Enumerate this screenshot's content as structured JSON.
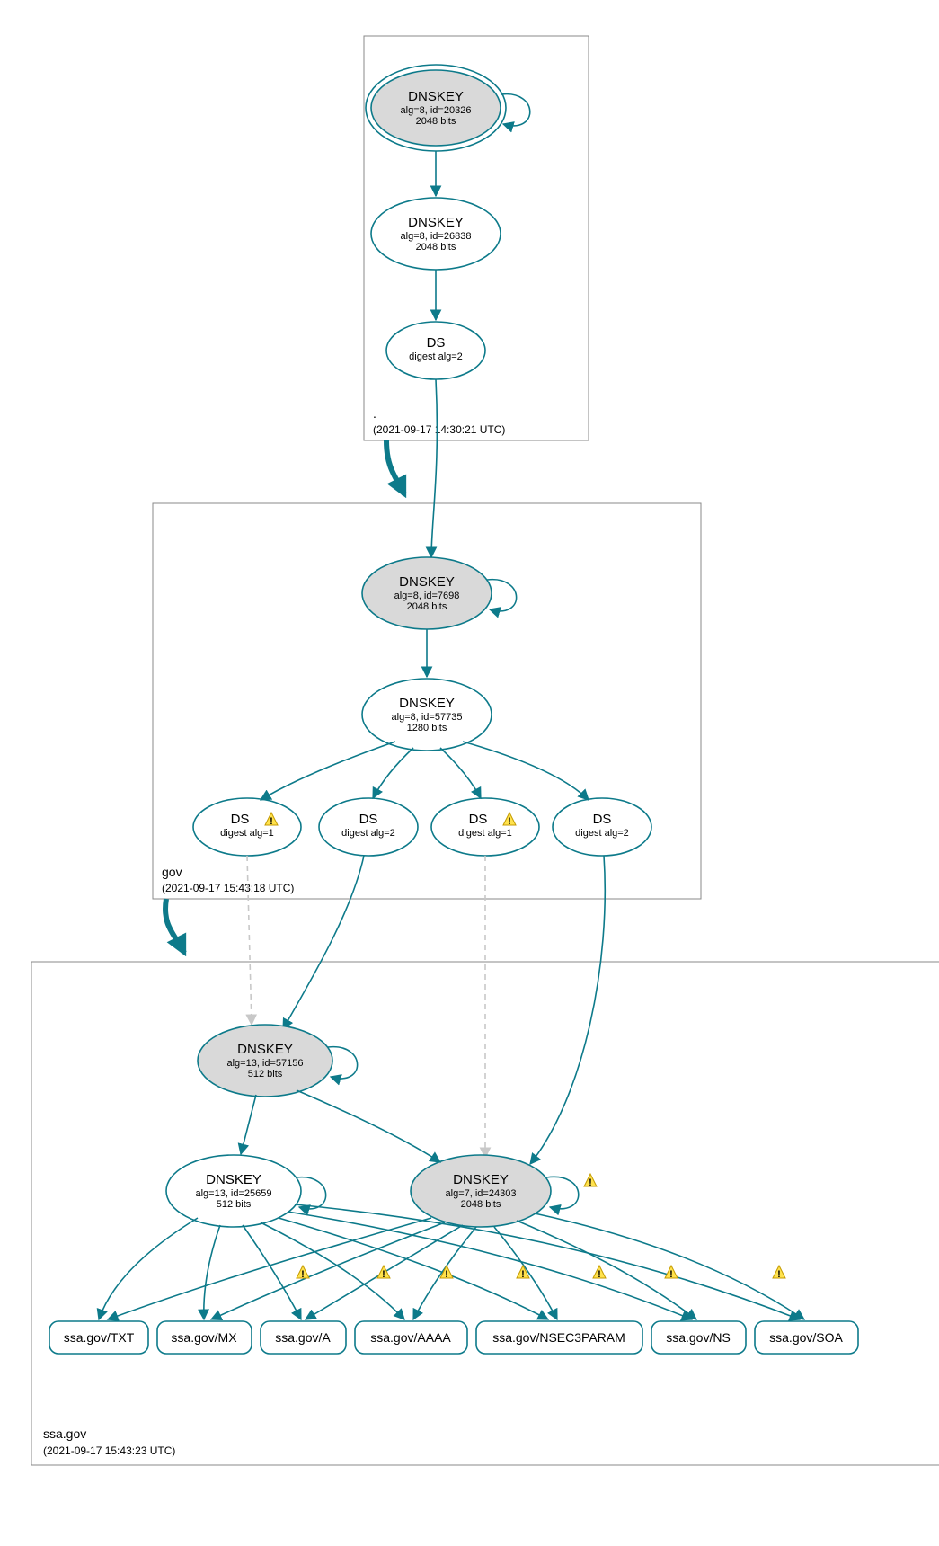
{
  "chart_data": {
    "type": "dnssec-delegation-graph",
    "zones": [
      {
        "name": ".",
        "timestamp": "(2021-09-17 14:30:21 UTC)",
        "nodes": [
          {
            "id": "root-ksk",
            "kind": "DNSKEY",
            "title": "DNSKEY",
            "line1": "alg=8, id=20326",
            "line2": "2048 bits",
            "ksk": true,
            "double_ring": true,
            "self_loop": true
          },
          {
            "id": "root-zsk",
            "kind": "DNSKEY",
            "title": "DNSKEY",
            "line1": "alg=8, id=26838",
            "line2": "2048 bits"
          },
          {
            "id": "root-ds",
            "kind": "DS",
            "title": "DS",
            "line1": "digest alg=2"
          }
        ],
        "edges": [
          {
            "from": "root-ksk",
            "to": "root-zsk"
          },
          {
            "from": "root-zsk",
            "to": "root-ds"
          }
        ]
      },
      {
        "name": "gov",
        "timestamp": "(2021-09-17 15:43:18 UTC)",
        "delegation_from": ".",
        "nodes": [
          {
            "id": "gov-ksk",
            "kind": "DNSKEY",
            "title": "DNSKEY",
            "line1": "alg=8, id=7698",
            "line2": "2048 bits",
            "ksk": true,
            "self_loop": true
          },
          {
            "id": "gov-zsk",
            "kind": "DNSKEY",
            "title": "DNSKEY",
            "line1": "alg=8, id=57735",
            "line2": "1280 bits"
          },
          {
            "id": "gov-ds1",
            "kind": "DS",
            "title": "DS",
            "line1": "digest alg=1",
            "warn": true
          },
          {
            "id": "gov-ds2",
            "kind": "DS",
            "title": "DS",
            "line1": "digest alg=2"
          },
          {
            "id": "gov-ds3",
            "kind": "DS",
            "title": "DS",
            "line1": "digest alg=1",
            "warn": true
          },
          {
            "id": "gov-ds4",
            "kind": "DS",
            "title": "DS",
            "line1": "digest alg=2"
          }
        ],
        "edges": [
          {
            "from": "root-ds",
            "to": "gov-ksk"
          },
          {
            "from": "gov-ksk",
            "to": "gov-zsk"
          },
          {
            "from": "gov-zsk",
            "to": "gov-ds1"
          },
          {
            "from": "gov-zsk",
            "to": "gov-ds2"
          },
          {
            "from": "gov-zsk",
            "to": "gov-ds3"
          },
          {
            "from": "gov-zsk",
            "to": "gov-ds4"
          }
        ]
      },
      {
        "name": "ssa.gov",
        "timestamp": "(2021-09-17 15:43:23 UTC)",
        "delegation_from": "gov",
        "nodes": [
          {
            "id": "ssa-ksk1",
            "kind": "DNSKEY",
            "title": "DNSKEY",
            "line1": "alg=13, id=57156",
            "line2": "512 bits",
            "ksk": true,
            "self_loop": true
          },
          {
            "id": "ssa-zsk",
            "kind": "DNSKEY",
            "title": "DNSKEY",
            "line1": "alg=13, id=25659",
            "line2": "512 bits",
            "self_loop": true
          },
          {
            "id": "ssa-ksk2",
            "kind": "DNSKEY",
            "title": "DNSKEY",
            "line1": "alg=7, id=24303",
            "line2": "2048 bits",
            "ksk": true,
            "self_loop": true,
            "loop_warn": true
          }
        ],
        "edges": [
          {
            "from": "gov-ds1",
            "to": "ssa-ksk1",
            "dashed": true
          },
          {
            "from": "gov-ds2",
            "to": "ssa-ksk1"
          },
          {
            "from": "gov-ds3",
            "to": "ssa-ksk2",
            "dashed": true
          },
          {
            "from": "gov-ds4",
            "to": "ssa-ksk2"
          },
          {
            "from": "ssa-ksk1",
            "to": "ssa-zsk"
          },
          {
            "from": "ssa-ksk1",
            "to": "ssa-ksk2"
          }
        ],
        "rrsets": [
          {
            "label": "ssa.gov/TXT"
          },
          {
            "label": "ssa.gov/MX"
          },
          {
            "label": "ssa.gov/A"
          },
          {
            "label": "ssa.gov/AAAA"
          },
          {
            "label": "ssa.gov/NSEC3PARAM"
          },
          {
            "label": "ssa.gov/NS"
          },
          {
            "label": "ssa.gov/SOA"
          }
        ],
        "rr_edges_from": [
          "ssa-zsk",
          "ssa-ksk2"
        ],
        "rr_edge_warn_for": "ssa-ksk2"
      }
    ]
  }
}
